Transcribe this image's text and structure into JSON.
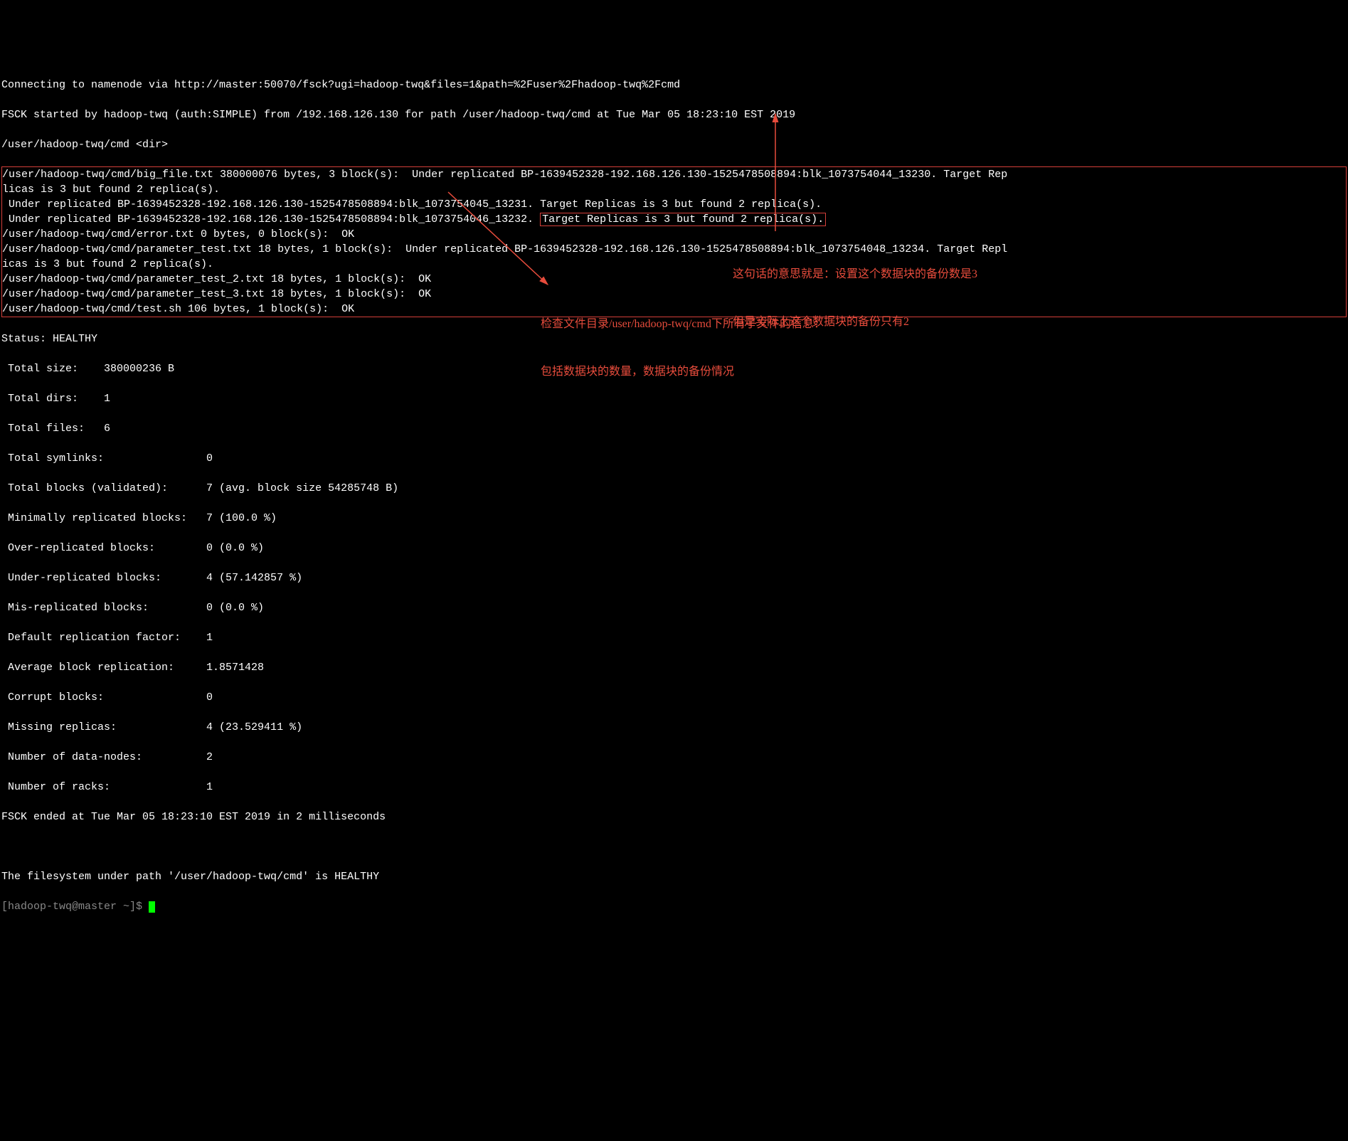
{
  "header": {
    "line1": "Connecting to namenode via http://master:50070/fsck?ugi=hadoop-twq&files=1&path=%2Fuser%2Fhadoop-twq%2Fcmd",
    "line2": "FSCK started by hadoop-twq (auth:SIMPLE) from /192.168.126.130 for path /user/hadoop-twq/cmd at Tue Mar 05 18:23:10 EST 2019",
    "line3": "/user/hadoop-twq/cmd <dir>"
  },
  "files_block": {
    "l1": "/user/hadoop-twq/cmd/big_file.txt 380000076 bytes, 3 block(s):  Under replicated BP-1639452328-192.168.126.130-1525478508894:blk_1073754044_13230. Target Rep",
    "l2": "licas is 3 but found 2 replica(s).",
    "l3": " Under replicated BP-1639452328-192.168.126.130-1525478508894:blk_1073754045_13231. Target Replicas is 3 but found 2 replica(s).",
    "l4_pre": " Under replicated BP-1639452328-192.168.126.130-1525478508894:blk_1073754046_13232. ",
    "l4_box": "Target Replicas is 3 but found 2 replica(s).",
    "l5": "/user/hadoop-twq/cmd/error.txt 0 bytes, 0 block(s):  OK",
    "l6": "/user/hadoop-twq/cmd/parameter_test.txt 18 bytes, 1 block(s):  Under replicated BP-1639452328-192.168.126.130-1525478508894:blk_1073754048_13234. Target Repl",
    "l7": "icas is 3 but found 2 replica(s).",
    "l8": "/user/hadoop-twq/cmd/parameter_test_2.txt 18 bytes, 1 block(s):  OK",
    "l9": "/user/hadoop-twq/cmd/parameter_test_3.txt 18 bytes, 1 block(s):  OK",
    "l10": "/user/hadoop-twq/cmd/test.sh 106 bytes, 1 block(s):  OK"
  },
  "status": {
    "header": "Status: HEALTHY",
    "r1": " Total size:    380000236 B",
    "r2": " Total dirs:    1",
    "r3": " Total files:   6",
    "r4": " Total symlinks:                0",
    "r5": " Total blocks (validated):      7 (avg. block size 54285748 B)",
    "r6": " Minimally replicated blocks:   7 (100.0 %)",
    "r7": " Over-replicated blocks:        0 (0.0 %)",
    "r8": " Under-replicated blocks:       4 (57.142857 %)",
    "r9": " Mis-replicated blocks:         0 (0.0 %)",
    "r10": " Default replication factor:    1",
    "r11": " Average block replication:     1.8571428",
    "r12": " Corrupt blocks:                0",
    "r13": " Missing replicas:              4 (23.529411 %)",
    "r14": " Number of data-nodes:          2",
    "r15": " Number of racks:               1",
    "end": "FSCK ended at Tue Mar 05 18:23:10 EST 2019 in 2 milliseconds"
  },
  "footer": {
    "blank": "",
    "healthy": "The filesystem under path '/user/hadoop-twq/cmd' is HEALTHY",
    "prompt": "[hadoop-twq@master ~]$ "
  },
  "annotations": {
    "a1_l1": "这句话的意思就是：设置这个数据块的备份数是3",
    "a1_l2": "但是实际上这个数据块的备份只有2",
    "a2_l1": "检查文件目录/user/hadoop-twq/cmd下所有子文件的信息：",
    "a2_l2": "包括数据块的数量，数据块的备份情况"
  }
}
